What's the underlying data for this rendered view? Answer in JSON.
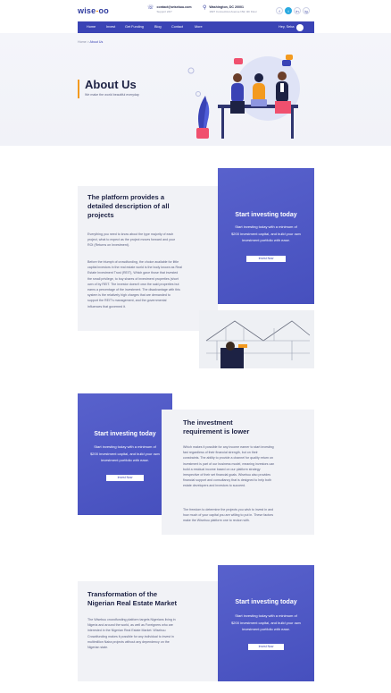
{
  "brand": {
    "logo_left": "wise",
    "logo_mid": "-",
    "logo_right": "oo"
  },
  "contact": {
    "email_label": "contact@wisebuu.com",
    "email_sub": "Support 24/7",
    "address_label": "Washington, DC 20001",
    "address_sub": "1827 Connecticut Avenue NW, 4th Floor"
  },
  "social": [
    "f",
    "t",
    "in",
    "ig"
  ],
  "nav": {
    "items": [
      "Home",
      "Invest",
      "Get Funding",
      "Blog",
      "Contact",
      "More"
    ],
    "greeting": "Hey, Seba"
  },
  "breadcrumb": {
    "home": "Home",
    "sep": ">",
    "current": "About Us"
  },
  "hero": {
    "title": "About Us",
    "subtitle": "We make the world beautiful everyday"
  },
  "section1": {
    "title_lines": [
      "The platform provides a",
      "detailed description of all",
      "projects"
    ],
    "para1": [
      "Everything you need to know about the type majority of each",
      "project, what to expect as the project moves forward and your",
      "ROI (Returns on Investment)."
    ],
    "para2": [
      "Before the triumph of crowdfunding, the choice available for little",
      "capital investors in the real estate world is the body known as Real",
      "Estate Investment Trust (REIT), Which gave those that invested",
      "the small privilege, to buy shares of investment properties (short",
      "own of by REIT. The investor doesn't own the said properties but",
      "earns a percentage of the investment. The disadvantage with this",
      "system is the relatively high charges that are demanded to",
      "support the REIT's management, and the governmental",
      "influences that governed it."
    ]
  },
  "cta": {
    "title": "Start investing today",
    "text_lines": [
      "Start investing today with a minimum of",
      "$200 investment capital, and build your own",
      "investment portfolio with ease."
    ],
    "button": "Invest Now"
  },
  "section2": {
    "title_lines": [
      "The investment",
      "requirement is lower"
    ],
    "para1": [
      "Which makes it possible for any income earner to start investing",
      "fast regardless of their financial strength, but on their",
      "constraints. The ability to provide a channel for quality return on",
      "investment is part of our business model, meaning investors can",
      "build a residual income based on our platform strategy",
      "irrespective of their set financial goals. Wisebuu also provides",
      "financial support and consultancy that is designed to help both",
      "estate developers and investors to succeed."
    ],
    "para2": [
      "The freedom to determine the projects you wish to invest in and",
      "how much of your capital you are willing to put in. These factors",
      "make the Wisebuu platform one to reckon with."
    ]
  },
  "section3": {
    "title_lines": [
      "Transformation of the",
      "Nigerian Real Estate Market"
    ],
    "para1": [
      "The Wisebuu crowdfunding platform targets Nigerians living in",
      "Nigeria and around the world, as well as Foreigners who are",
      "interested in the Nigerian Real Estate Market. Wisebuu",
      "Crowdfunding makes it possible for any individual to invest in",
      "multimillion Naira projects without any dependency on the",
      "Nigerian state."
    ]
  },
  "colors": {
    "brand": "#3a43b5",
    "accent": "#f39a1f",
    "panel": "#f1f2f6"
  }
}
